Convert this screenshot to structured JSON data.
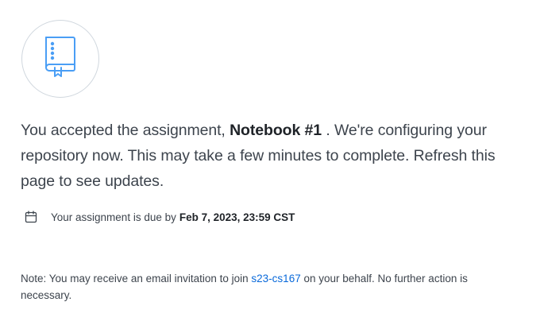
{
  "icons": {
    "notebook": "notebook-icon",
    "calendar": "calendar-icon"
  },
  "colors": {
    "accent": "#0969da",
    "text": "#3d444d",
    "heading_text": "#1f2328",
    "border": "#d0d7de",
    "icon_blue": "#4a9ef5"
  },
  "message": {
    "prefix": "You accepted the assignment, ",
    "assignment_name": "Notebook #1",
    "suffix": " . We're configuring your repository now. This may take a few minutes to complete. Refresh this page to see updates."
  },
  "due": {
    "label": "Your assignment is due by",
    "date": "Feb 7, 2023, 23:59 CST"
  },
  "note": {
    "prefix": "Note: You may receive an email invitation to join ",
    "org_link": "s23-cs167",
    "suffix": " on your behalf. No further action is necessary."
  }
}
